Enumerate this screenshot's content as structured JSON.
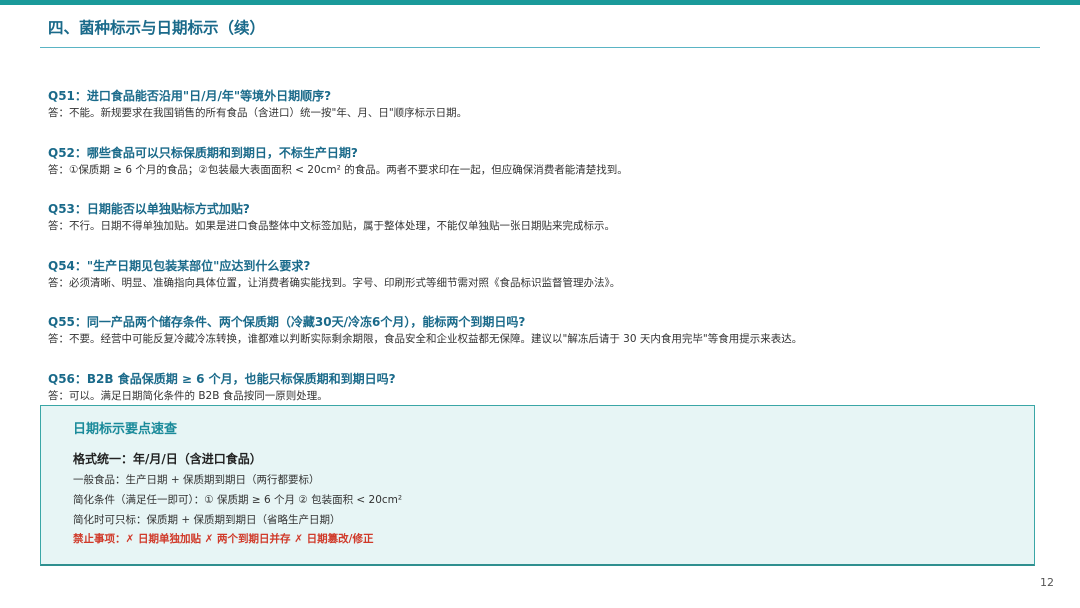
{
  "header": {
    "title": "四、菌种标示与日期标示（续）"
  },
  "qa": [
    {
      "question": "Q51：进口食品能否沿用\"日/月/年\"等境外日期顺序?",
      "answer": "答：不能。新规要求在我国销售的所有食品（含进口）统一按\"年、月、日\"顺序标示日期。"
    },
    {
      "question": "Q52：哪些食品可以只标保质期和到期日，不标生产日期?",
      "answer": "答：①保质期 ≥ 6 个月的食品；②包装最大表面面积 < 20cm² 的食品。两者不要求印在一起，但应确保消费者能清楚找到。"
    },
    {
      "question": "Q53：日期能否以单独贴标方式加贴?",
      "answer": "答：不行。日期不得单独加贴。如果是进口食品整体中文标签加贴，属于整体处理，不能仅单独贴一张日期贴来完成标示。"
    },
    {
      "question": "Q54：\"生产日期见包装某部位\"应达到什么要求?",
      "answer": "答：必须清晰、明显、准确指向具体位置，让消费者确实能找到。字号、印刷形式等细节需对照《食品标识监督管理办法》。"
    },
    {
      "question": "Q55：同一产品两个储存条件、两个保质期（冷藏30天/冷冻6个月），能标两个到期日吗?",
      "answer": "答：不要。经营中可能反复冷藏冷冻转换，谁都难以判断实际剩余期限，食品安全和企业权益都无保障。建议以\"解冻后请于 30 天内食用完毕\"等食用提示来表达。"
    },
    {
      "question": "Q56：B2B 食品保质期 ≥ 6 个月，也能只标保质期和到期日吗?",
      "answer": "答：可以。满足日期简化条件的 B2B 食品按同一原则处理。"
    }
  ],
  "summary": {
    "title": "日期标示要点速查",
    "heading": "格式统一：年/月/日（含进口食品）",
    "line1": "一般食品：生产日期 + 保质期到期日（两行都要标）",
    "line2": "简化条件（满足任一即可）：① 保质期 ≥ 6 个月  ② 包装面积 < 20cm²",
    "line3": "简化时可只标：保质期 + 保质期到期日（省略生产日期）",
    "warning": "禁止事项：✗ 日期单独加贴  ✗ 两个到期日并存  ✗ 日期篡改/修正"
  },
  "footer": {
    "page_number": "12"
  }
}
